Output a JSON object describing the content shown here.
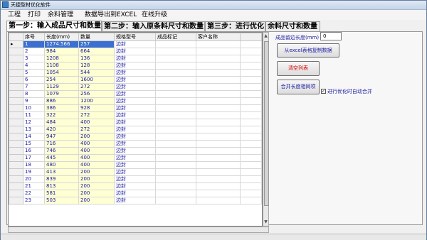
{
  "window": {
    "title": "天捷型材优化软件"
  },
  "menu": [
    "工程",
    "打印",
    "余料管理",
    "数据导出到EXCEL",
    "在线升级"
  ],
  "tabs": [
    "第一步：输入成品尺寸和数量",
    "第二步：输入原条料尺寸和数量",
    "第三步：进行优化",
    "余料尺寸和数量"
  ],
  "grid": {
    "columns": [
      "序号",
      "长度(mm)",
      "数量",
      "规格型号",
      "成品标记",
      "客户名称"
    ],
    "rows": [
      {
        "seq": "1",
        "len": "1274.566",
        "qty": "257",
        "spec": "边封"
      },
      {
        "seq": "2",
        "len": "984",
        "qty": "664",
        "spec": "边封"
      },
      {
        "seq": "3",
        "len": "1208",
        "qty": "136",
        "spec": "边封"
      },
      {
        "seq": "4",
        "len": "1108",
        "qty": "128",
        "spec": "边封"
      },
      {
        "seq": "5",
        "len": "1054",
        "qty": "544",
        "spec": "边封"
      },
      {
        "seq": "6",
        "len": "254",
        "qty": "1600",
        "spec": "边封"
      },
      {
        "seq": "7",
        "len": "1129",
        "qty": "272",
        "spec": "边封"
      },
      {
        "seq": "8",
        "len": "1079",
        "qty": "256",
        "spec": "边封"
      },
      {
        "seq": "9",
        "len": "886",
        "qty": "1200",
        "spec": "边封"
      },
      {
        "seq": "10",
        "len": "386",
        "qty": "928",
        "spec": "边封"
      },
      {
        "seq": "11",
        "len": "322",
        "qty": "272",
        "spec": "边封"
      },
      {
        "seq": "12",
        "len": "484",
        "qty": "400",
        "spec": "边封"
      },
      {
        "seq": "13",
        "len": "420",
        "qty": "272",
        "spec": "边封"
      },
      {
        "seq": "14",
        "len": "947",
        "qty": "200",
        "spec": "边封"
      },
      {
        "seq": "15",
        "len": "716",
        "qty": "400",
        "spec": "边封"
      },
      {
        "seq": "16",
        "len": "746",
        "qty": "400",
        "spec": "边封"
      },
      {
        "seq": "17",
        "len": "445",
        "qty": "400",
        "spec": "边封"
      },
      {
        "seq": "18",
        "len": "480",
        "qty": "400",
        "spec": "边封"
      },
      {
        "seq": "19",
        "len": "413",
        "qty": "200",
        "spec": "边封"
      },
      {
        "seq": "20",
        "len": "839",
        "qty": "200",
        "spec": "边封"
      },
      {
        "seq": "21",
        "len": "813",
        "qty": "200",
        "spec": "边封"
      },
      {
        "seq": "22",
        "len": "581",
        "qty": "200",
        "spec": "边封"
      },
      {
        "seq": "23",
        "len": "503",
        "qty": "200",
        "spec": "边封"
      }
    ]
  },
  "side": {
    "margin_label": "成品留边长度(mm)",
    "margin_value": "0",
    "copy_excel_button": "从excel表格复制数据",
    "clear_button": "清空列表",
    "merge_button": "合并长度相同项",
    "auto_merge_label": "进行优化时自动合并",
    "auto_merge_checked": true
  }
}
